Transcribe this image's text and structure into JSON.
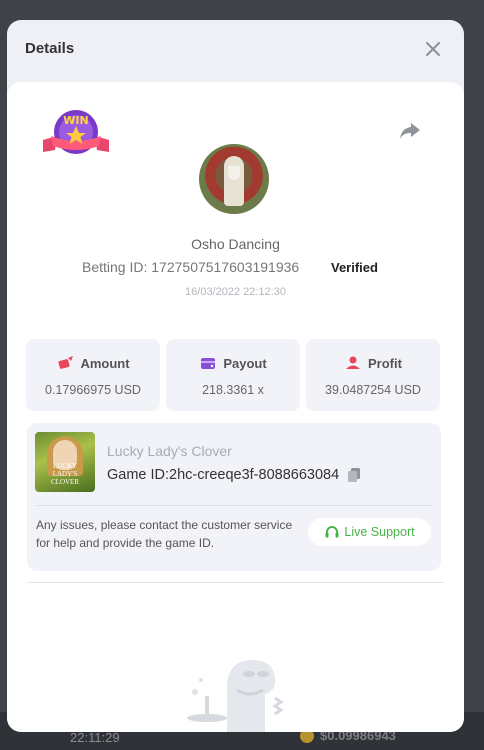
{
  "background": {
    "time": "22:11:29",
    "amount": "$0.09986943"
  },
  "modal": {
    "title": "Details",
    "close_icon": "close-icon"
  },
  "bet": {
    "game_name": "Osho Dancing",
    "betting_id_label": "Betting ID:",
    "betting_id": "1727507517603191936",
    "verified_label": "Verified",
    "timestamp": "16/03/2022 22:12:30"
  },
  "stats": [
    {
      "label": "Amount",
      "value": "0.17966975 USD",
      "icon": "money-wings-icon",
      "color": "#e8465b"
    },
    {
      "label": "Payout",
      "value": "218.3361 x",
      "icon": "wallet-icon",
      "color": "#8a4fd8"
    },
    {
      "label": "Profit",
      "value": "39.0487254 USD",
      "icon": "profit-icon",
      "color": "#e8465b"
    }
  ],
  "game": {
    "title": "Lucky Lady's Clover",
    "id_label": "Game ID:",
    "id": "2hc-creeqe3f-8088663084",
    "thumb_caption": "LUCKY LADY'S CLOVER"
  },
  "support": {
    "message": "Any issues, please contact the customer service for help and provide the game ID.",
    "button_label": "Live Support",
    "accent": "#49b34a"
  }
}
